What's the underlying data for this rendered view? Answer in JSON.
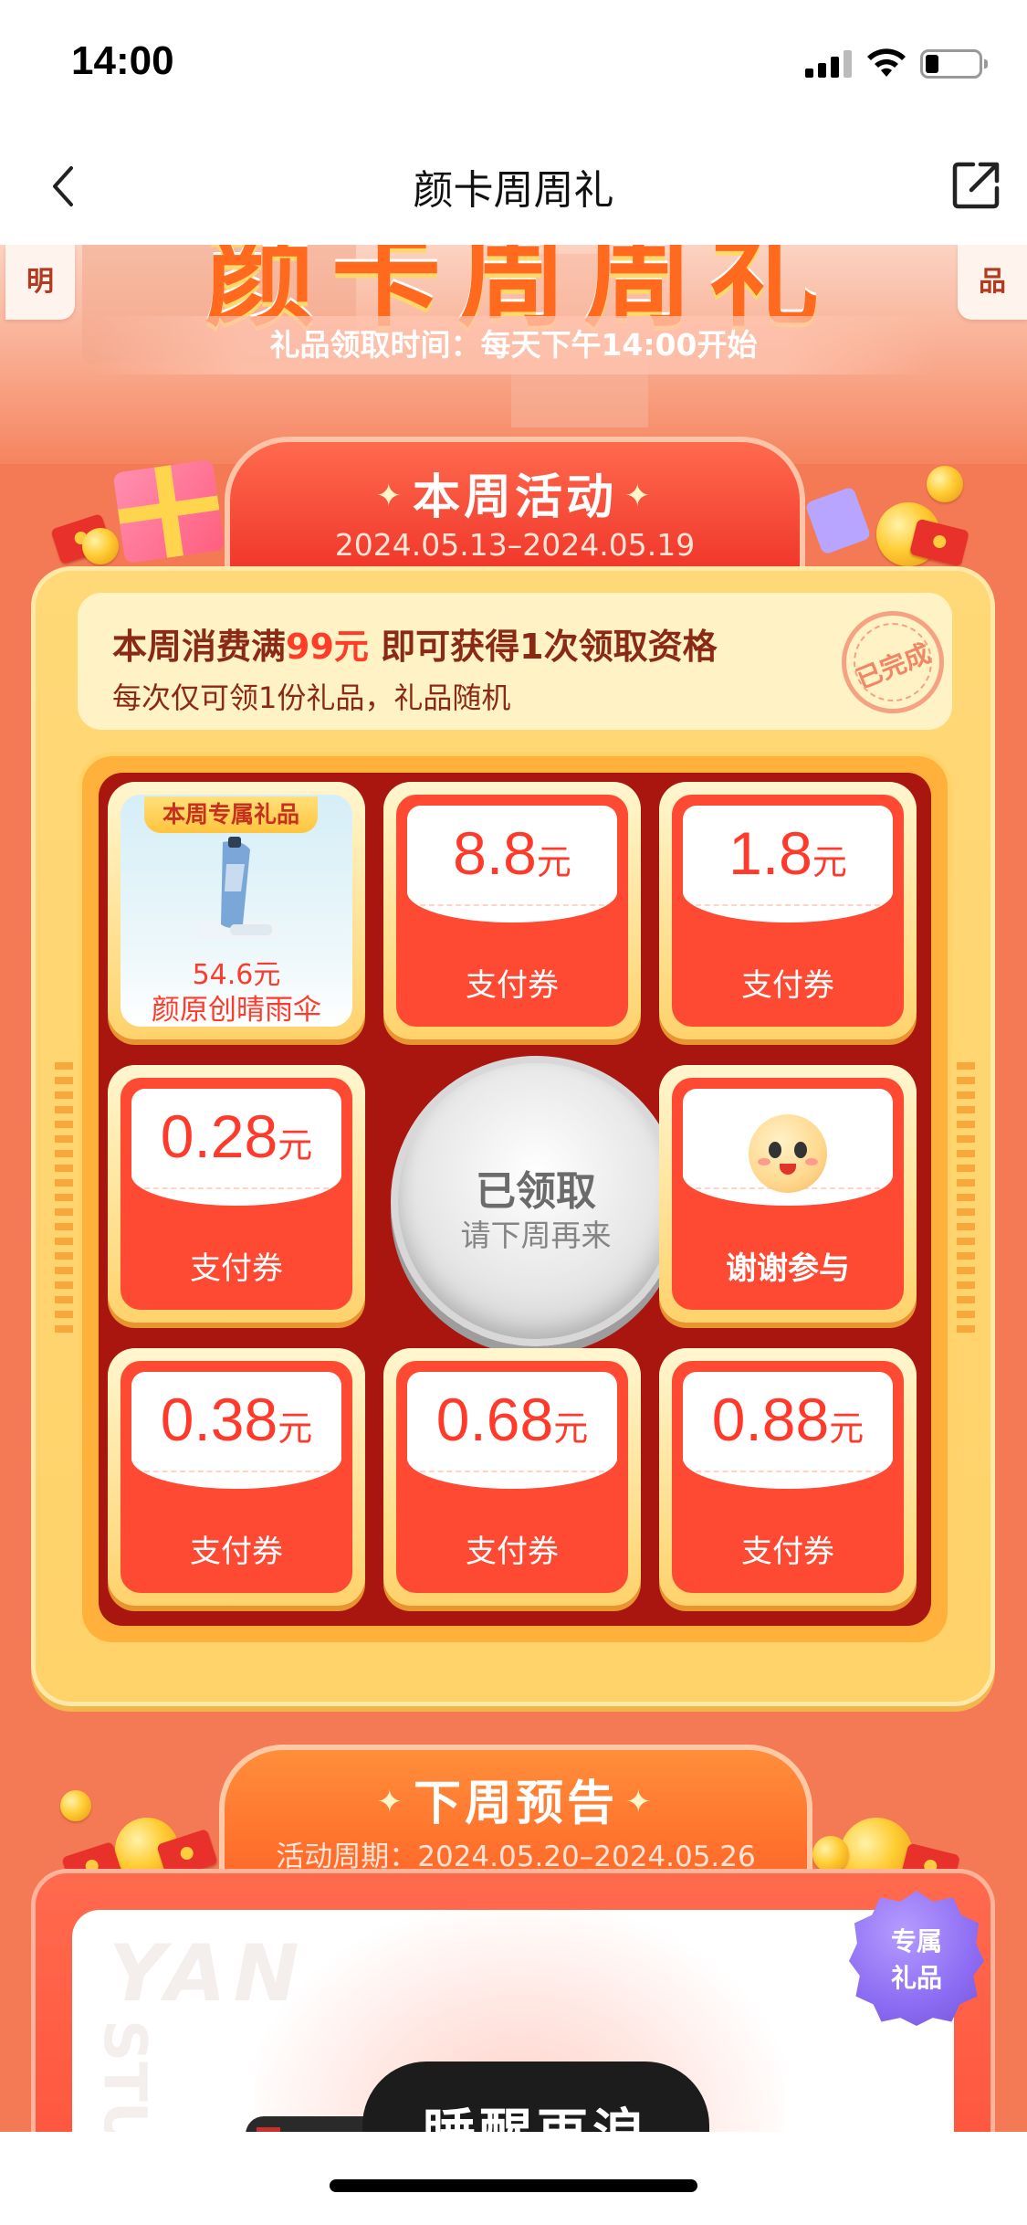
{
  "status_bar": {
    "time": "14:00"
  },
  "nav": {
    "title": "颜卡周周礼"
  },
  "hero": {
    "banner_title": "颜卡周周礼",
    "rules_tab": "明",
    "gift_tab": "品",
    "gift_time": "礼品领取时间：每天下午14:00开始"
  },
  "this_week": {
    "title": "本周活动",
    "period": "2024.05.13–2024.05.19",
    "requirement_prefix": "本周消费满",
    "requirement_amount": "99元",
    "requirement_suffix": " 即可获得1次领取资格",
    "requirement_sub": "每次仅可领1份礼品，礼品随机",
    "stamp": "已完成",
    "featured_gift": {
      "badge": "本周专属礼品",
      "price": "54.6元",
      "name": "颜原创晴雨伞"
    },
    "prizes": [
      {
        "amount": "8.8",
        "unit": "元",
        "label": "支付券"
      },
      {
        "amount": "1.8",
        "unit": "元",
        "label": "支付券"
      },
      {
        "amount": "0.28",
        "unit": "元",
        "label": "支付券"
      },
      {
        "label": "谢谢参与",
        "icon": "smiley-icon"
      },
      {
        "amount": "0.38",
        "unit": "元",
        "label": "支付券"
      },
      {
        "amount": "0.68",
        "unit": "元",
        "label": "支付券"
      },
      {
        "amount": "0.88",
        "unit": "元",
        "label": "支付券"
      }
    ],
    "center_button": {
      "title": "已领取",
      "sub": "请下周再来"
    }
  },
  "next_week": {
    "title": "下周预告",
    "period": "活动周期：2024.05.20–2024.05.26",
    "badge_line1": "专属",
    "badge_line2": "礼品",
    "product_text": "睡醒再浪",
    "watermark": "YAN",
    "watermark_2": "STU"
  },
  "colors": {
    "accent_red": "#ff3a2b",
    "gold": "#ffd26a",
    "page_bg": "#f47a55"
  }
}
